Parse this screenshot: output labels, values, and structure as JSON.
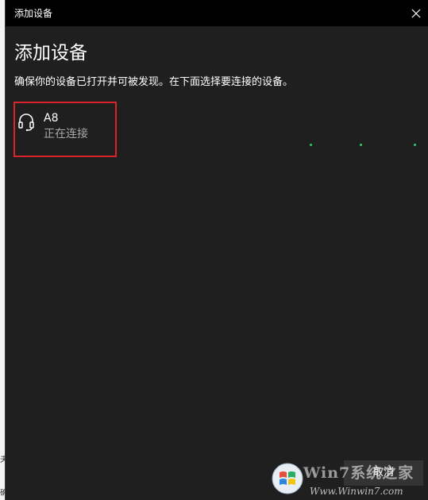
{
  "window": {
    "title": "添加设备"
  },
  "main": {
    "heading": "添加设备",
    "instruction": "确保你的设备已打开并可被发现。在下面选择要连接的设备。"
  },
  "devices": [
    {
      "name": "A8",
      "status": "正在连接",
      "icon": "headset-icon"
    }
  ],
  "footer": {
    "cancel_label": "取消"
  },
  "watermark": {
    "brand": "Win7系统之家",
    "url": "Www.Winwin7.com"
  },
  "colors": {
    "background": "#1f1f1f",
    "titlebar": "#000000",
    "highlight_border": "#d9242b",
    "progress_dots": "#2ecc71",
    "secondary_text": "#a8a8a8"
  }
}
